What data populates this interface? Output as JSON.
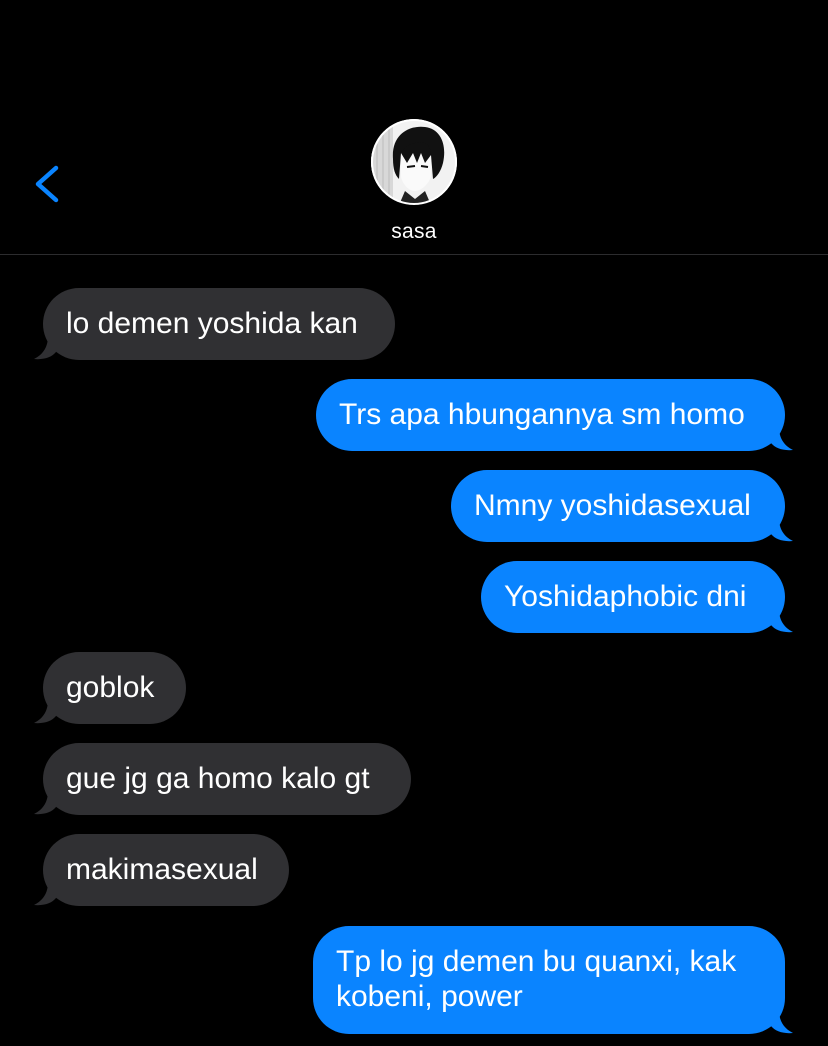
{
  "header": {
    "contact_name": "sasa"
  },
  "icons": {
    "back": "chevron-left-icon",
    "avatar": "contact-avatar"
  },
  "colors": {
    "background": "#000000",
    "sent_bubble": "#0a84ff",
    "received_bubble": "#303033",
    "accent": "#0a84ff"
  },
  "messages": [
    {
      "direction": "received",
      "text": "lo demen yoshida kan"
    },
    {
      "direction": "sent",
      "text": "Trs apa hbungannya sm homo"
    },
    {
      "direction": "sent",
      "text": "Nmny yoshidasexual"
    },
    {
      "direction": "sent",
      "text": "Yoshidaphobic dni"
    },
    {
      "direction": "received",
      "text": "goblok"
    },
    {
      "direction": "received",
      "text": "gue jg ga homo kalo gt"
    },
    {
      "direction": "received",
      "text": "makimasexual"
    },
    {
      "direction": "sent",
      "text": "Tp lo jg demen bu quanxi, kak kobeni, power"
    }
  ]
}
